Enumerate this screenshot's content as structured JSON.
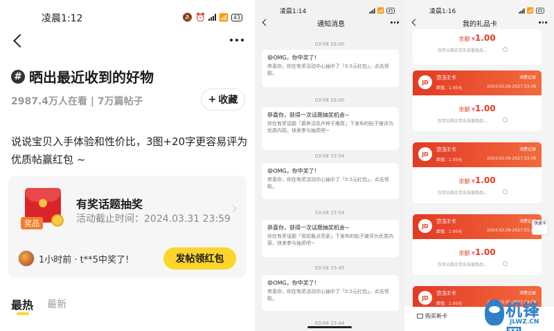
{
  "panel1": {
    "status_time": "凌晨1:12",
    "battery": "43",
    "topic_title": "晒出最近收到的好物",
    "hash_symbol": "#",
    "stats": "2987.4万人在看 | 7万篇帖子",
    "collect_label": "收藏",
    "collect_plus": "+",
    "description": "说说宝贝入手体验和性价比，3图+20字更容易评为优质帖赢红包 ~",
    "award": {
      "tag": "奖品",
      "title": "有奖话题抽奖",
      "deadline": "活动截止时间：2024.03.31 23:59",
      "winner_text": "1小时前 · t**5中奖了!",
      "post_button": "发帖领红包"
    },
    "tabs": {
      "hot": "最热",
      "new": "最新"
    }
  },
  "panel2": {
    "status_time": "凌晨1:14",
    "battery": "45",
    "nav_title": "通知消息",
    "messages": [
      {
        "time": "03-08 16:00",
        "title": "😄OMG，你中奖了!",
        "body": "恭喜你，你在有奖活动中心抽中了「0.5元红包」，点击领取。"
      },
      {
        "time": "03-08 16:00",
        "title": "恭喜你，获得一次话题抽奖机会~",
        "body": "你在有奖话题「慕养活花卉种子推荐」下发布的帖子被评为优质内容，快来参与抽奖吧~"
      },
      {
        "time": "03-08 15:54",
        "title": "😄OMG，你中奖了!",
        "body": "恭喜你，你在有奖活动中心抽中了「0.5元红包」，点击领取。"
      },
      {
        "time": "03-08 15:54",
        "title": "恭喜你，获得一次话题抽奖机会~",
        "body": "你在有奖话题「用花瓶点亮家」下发布的帖子被评为优质内容，快来参与抽奖吧~"
      },
      {
        "time": "03-08 15:45",
        "title": "😄OMG，你中奖了!",
        "body": "恭喜你，你在有奖活动中心抽中了「0.5元红包」，点击领取。"
      },
      {
        "time": "03-08 15:44",
        "title": "",
        "body": ""
      }
    ]
  },
  "panel3": {
    "status_time": "凌晨1:16",
    "battery": "45",
    "nav_title": "我的礼品卡",
    "card_common": {
      "logo": "JD",
      "name": "京东E卡",
      "face": "面值：1.00元",
      "records": "消费记录",
      "dates": "2024.03.09-2027.03.09",
      "balance_label": "余额 ¥",
      "balance": "1.00",
      "note": "仅可以购买京东自营商品..."
    },
    "top_card": {
      "balance_label": "余额 ¥",
      "balance": "1.00",
      "note": "仅可以购买京东自营商品..."
    },
    "buy_label": "购买新卡",
    "side_widget": "快递卡",
    "watermark": {
      "big": "机锋网",
      "small": "JLWZ.CN"
    }
  }
}
